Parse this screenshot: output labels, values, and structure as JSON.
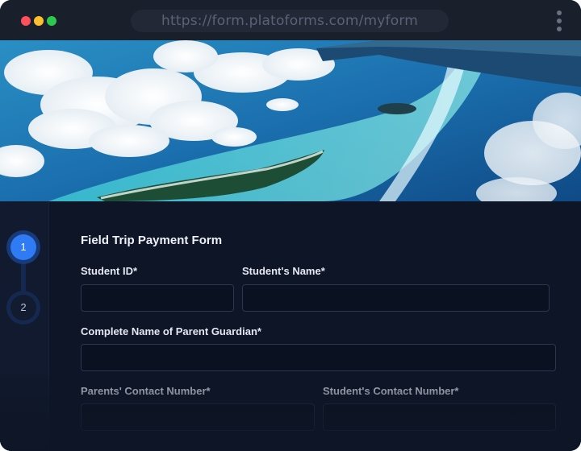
{
  "browser": {
    "url": "https://form.platoforms.com/myform"
  },
  "hero": {
    "image": "aerial view of tropical islands and turquoise sea with clouds and airplane wing"
  },
  "stepper": {
    "steps": [
      {
        "number": "1",
        "active": true
      },
      {
        "number": "2",
        "active": false
      }
    ]
  },
  "form": {
    "title": "Field Trip Payment Form",
    "fields": {
      "student_id": {
        "label": "Student ID*",
        "value": ""
      },
      "student_name": {
        "label": "Student's Name*",
        "value": ""
      },
      "parent_guardian": {
        "label": "Complete Name of Parent Guardian*",
        "value": ""
      },
      "parents_contact": {
        "label": "Parents' Contact Number*",
        "value": ""
      },
      "students_contact": {
        "label": "Student's Contact Number*",
        "value": ""
      }
    }
  },
  "colors": {
    "accent": "#2f7bf5",
    "background": "#0e1526"
  }
}
